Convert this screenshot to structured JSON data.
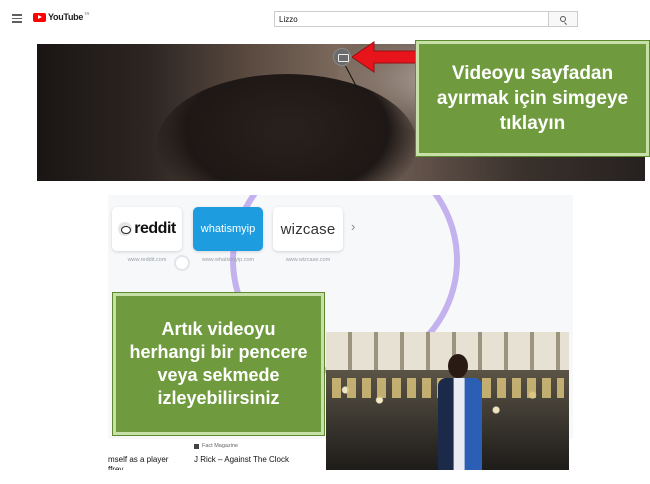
{
  "header": {
    "menu_icon": "hamburger-menu-icon",
    "logo_text": "YouTube",
    "logo_region": "TR",
    "search_value": "Lizzo",
    "search_icon": "search-icon"
  },
  "video": {
    "pip_icon": "picture-in-picture-icon"
  },
  "callouts": {
    "top": "Videoyu sayfadan ayırmak için simgeye tıklayın",
    "bottom": "Artık videoyu herhangi bir pencere veya sekmede izleyebilirsiniz"
  },
  "newtab": {
    "tiles": [
      {
        "name": "reddit",
        "url": "www.reddit.com"
      },
      {
        "name": "whatismyip",
        "url": "www.whatismyip.com"
      },
      {
        "name": "wizcase",
        "url": "www.wizcase.com"
      }
    ],
    "feed": {
      "left_title_line1": "mself as a player",
      "left_title_line2": "ffrey",
      "source": "Fact Magazine",
      "title": "J Rick – Against The Clock"
    }
  },
  "colors": {
    "callout_green": "#6f9b3e",
    "callout_border": "#c7e0a8",
    "arrow_red": "#e8141b",
    "youtube_red": "#ff0000",
    "whatismyip_blue": "#1e9ce0",
    "deco_purple": "#c4b2ee"
  }
}
